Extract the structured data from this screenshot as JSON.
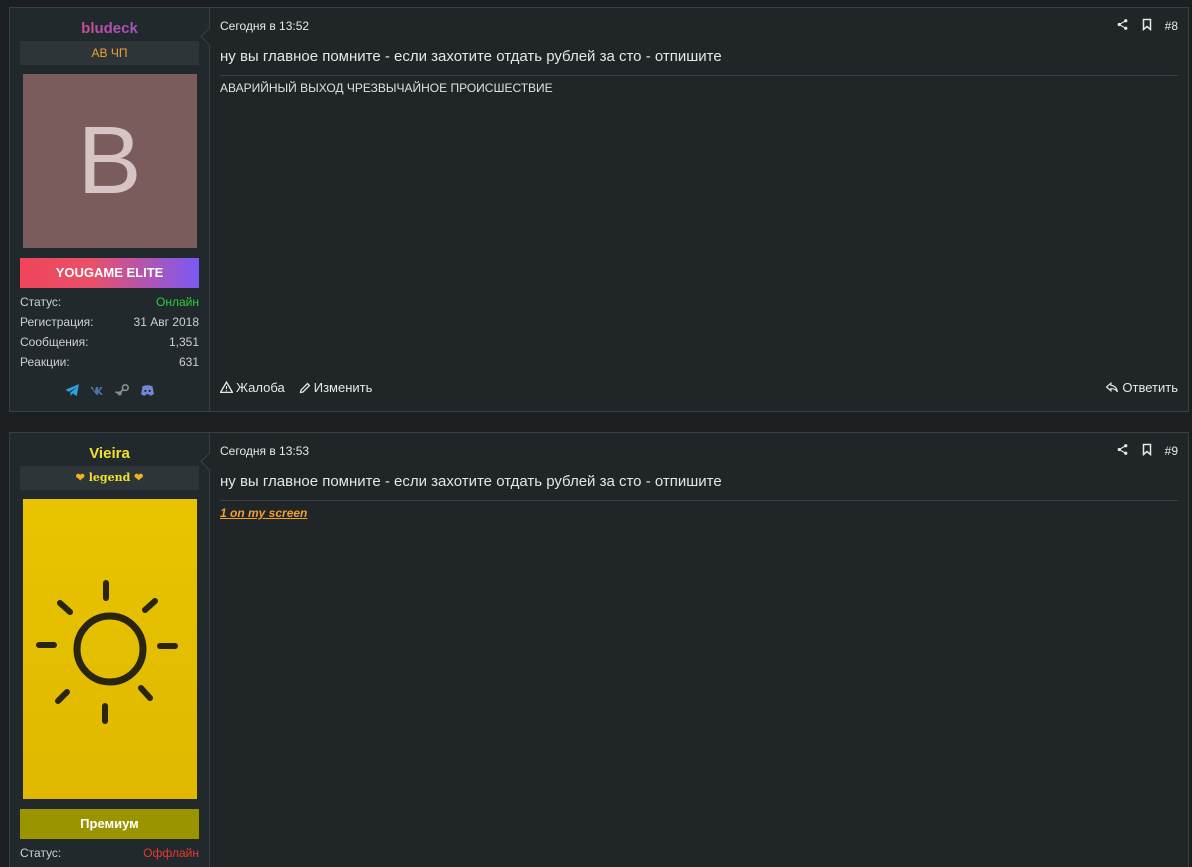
{
  "posts": [
    {
      "username": "bludeck",
      "user_title": "АВ ЧП",
      "avatar_letter": "B",
      "avatar_color": "#7a5c5c",
      "banner": "YOUGAME ELITE",
      "stats": [
        {
          "label": "Статус:",
          "value": "Онлайн"
        },
        {
          "label": "Регистрация:",
          "value": "31 Авг 2018"
        },
        {
          "label": "Сообщения:",
          "value": "1,351"
        },
        {
          "label": "Реакции:",
          "value": "631"
        }
      ],
      "socials": [
        "telegram-icon",
        "vk-icon",
        "steam-icon",
        "discord-icon"
      ],
      "date": "Сегодня в 13:52",
      "number": "#8",
      "quote": "ну вы главное помните - если захотите отдать рублей за сто - отпишите",
      "body": "АВАРИЙНЫЙ ВЫХОД ЧРЕЗВЫЧАЙНОЕ ПРОИСШЕСТВИЕ",
      "report": "Жалоба",
      "edit": "Изменить",
      "reply": "Ответить"
    },
    {
      "username": "Vieira",
      "user_title": "legend",
      "banner": "Премиум",
      "banner_color": "#9a9400",
      "stats": [
        {
          "label": "Статус:",
          "value": "Оффлайн"
        }
      ],
      "date": "Сегодня в 13:53",
      "number": "#9",
      "quote": "ну вы главное помните - если захотите отдать рублей за сто - отпишите",
      "body_link": "1 on my screen"
    }
  ],
  "colors": {
    "online": "#2ecc40",
    "offline": "#e53935",
    "accent": "#f0a030"
  }
}
